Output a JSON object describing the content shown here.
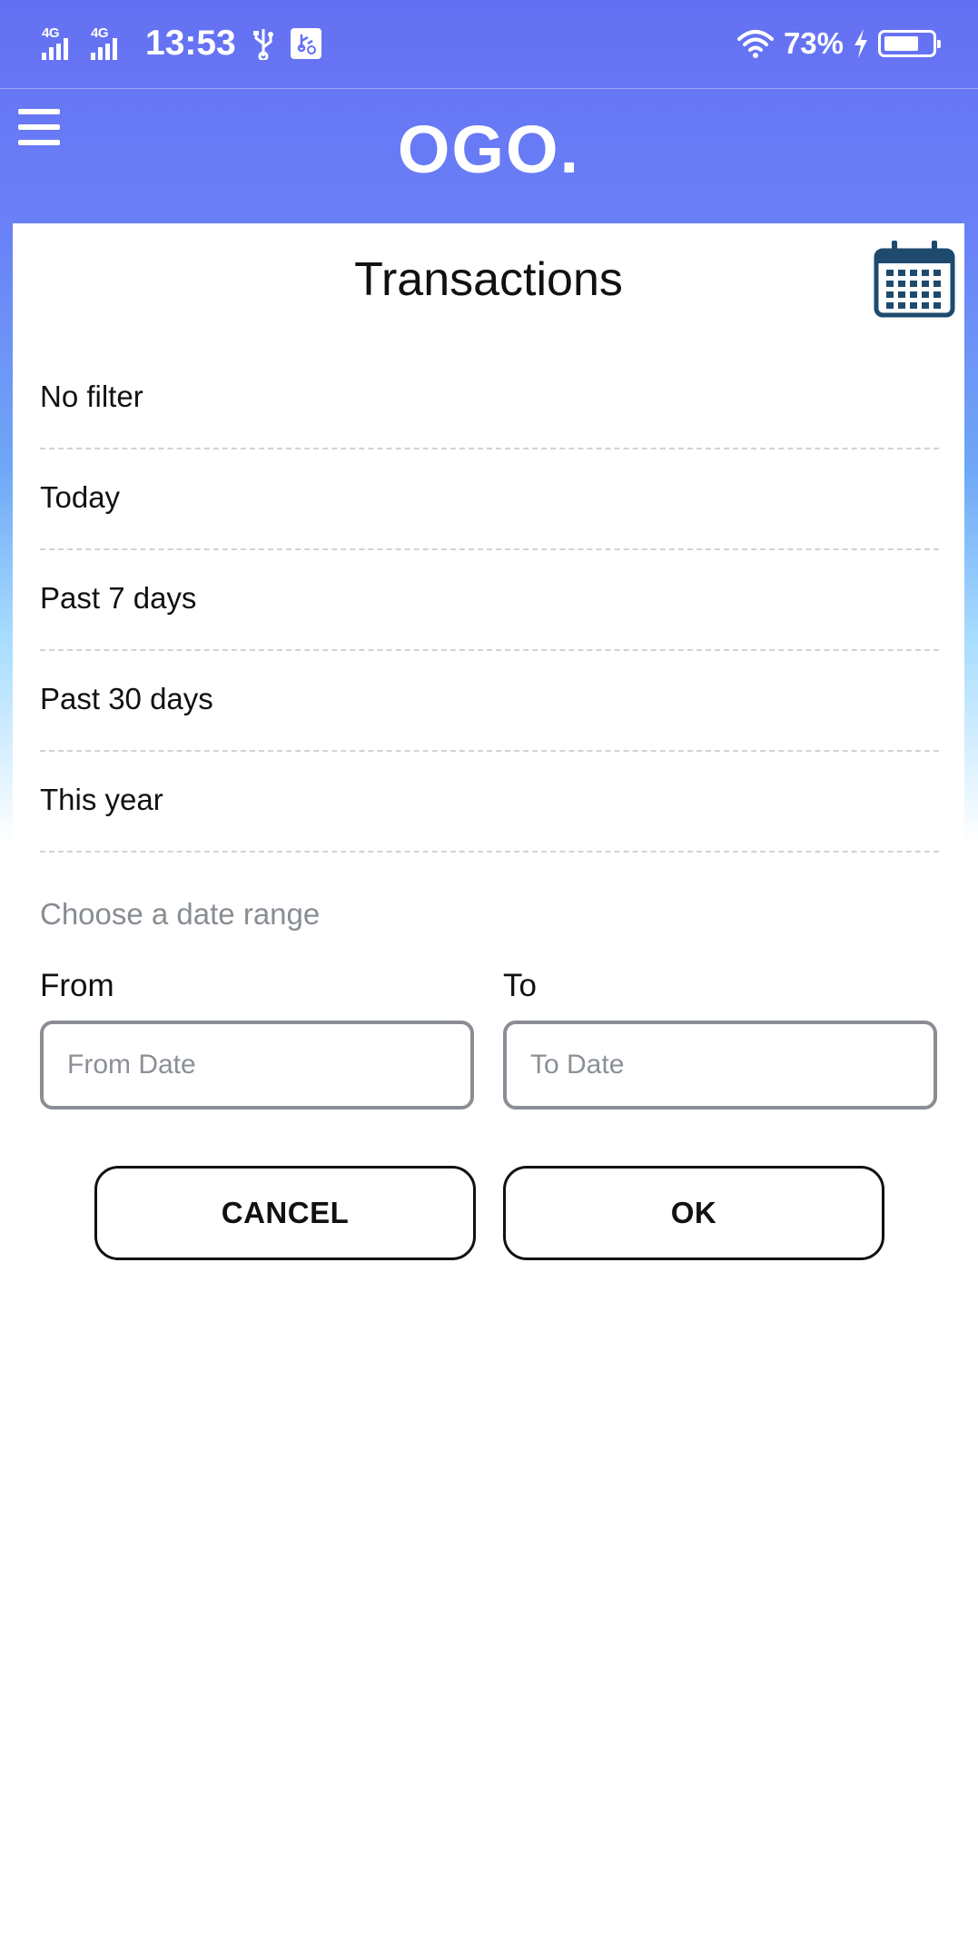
{
  "status_bar": {
    "network_1": "4G",
    "network_2": "4G",
    "time": "13:53",
    "battery_percent": "73%",
    "battery_level": 0.73,
    "icons": [
      "usb-icon",
      "sd-card-icon",
      "wifi-icon",
      "charging-icon",
      "battery-icon"
    ]
  },
  "header": {
    "menu_icon": "hamburger-menu-icon",
    "logo": "OGO."
  },
  "page": {
    "title": "Transactions",
    "calendar_icon": "calendar-icon"
  },
  "filters": [
    {
      "label": "No filter"
    },
    {
      "label": "Today"
    },
    {
      "label": "Past 7 days"
    },
    {
      "label": "Past 30 days"
    },
    {
      "label": "This year"
    }
  ],
  "date_range": {
    "heading": "Choose a date range",
    "from_label": "From",
    "to_label": "To",
    "from_placeholder": "From Date",
    "to_placeholder": "To Date",
    "from_value": "",
    "to_value": ""
  },
  "actions": {
    "cancel_label": "CANCEL",
    "ok_label": "OK"
  },
  "colors": {
    "header_blue": "#6470f2",
    "calendar_icon": "#1e4a6e",
    "input_border": "#8a8e94",
    "muted_text": "#888d94"
  }
}
